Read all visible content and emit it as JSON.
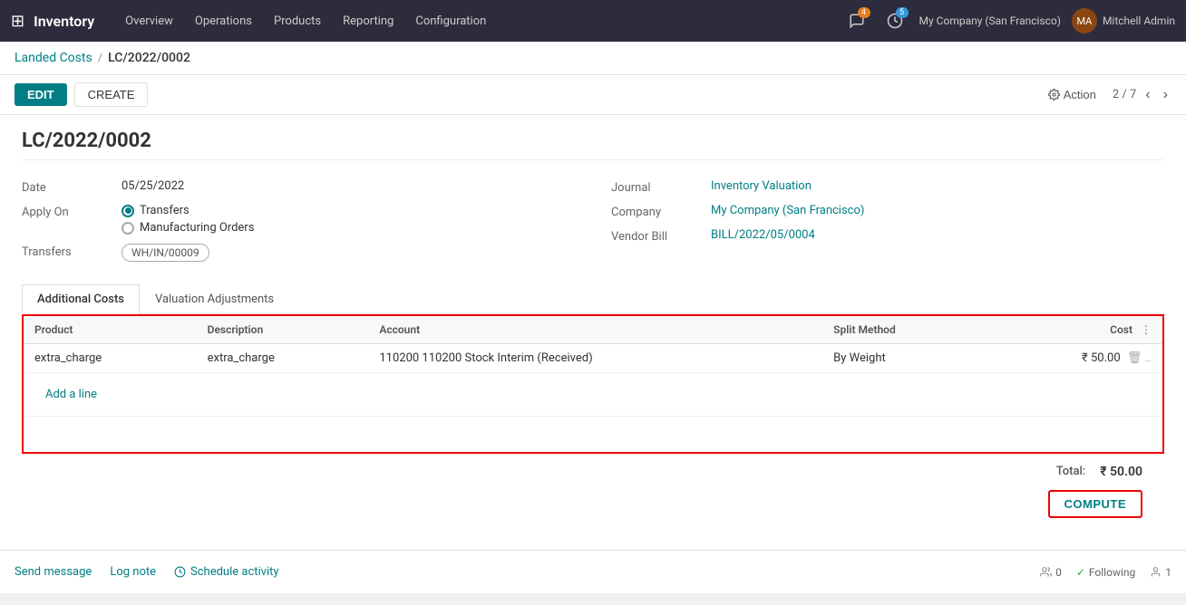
{
  "topnav": {
    "brand": "Inventory",
    "items": [
      {
        "label": "Overview",
        "id": "overview"
      },
      {
        "label": "Operations",
        "id": "operations"
      },
      {
        "label": "Products",
        "id": "products"
      },
      {
        "label": "Reporting",
        "id": "reporting"
      },
      {
        "label": "Configuration",
        "id": "configuration"
      }
    ],
    "notification_count": "4",
    "activity_count": "5",
    "company": "My Company (San Francisco)",
    "user": "Mitchell Admin"
  },
  "breadcrumb": {
    "parent": "Landed Costs",
    "separator": "/",
    "current": "LC/2022/0002"
  },
  "toolbar": {
    "edit_label": "EDIT",
    "create_label": "CREATE",
    "action_label": "Action",
    "pagination": "2 / 7"
  },
  "record": {
    "title": "LC/2022/0002",
    "date_label": "Date",
    "date_value": "05/25/2022",
    "apply_on_label": "Apply On",
    "apply_on_transfers": "Transfers",
    "apply_on_mfg": "Manufacturing Orders",
    "transfers_label": "Transfers",
    "transfers_value": "WH/IN/00009",
    "journal_label": "Journal",
    "journal_value": "Inventory Valuation",
    "company_label": "Company",
    "company_value": "My Company (San Francisco)",
    "vendor_bill_label": "Vendor Bill",
    "vendor_bill_value": "BILL/2022/05/0004"
  },
  "tabs": [
    {
      "label": "Additional Costs",
      "id": "additional-costs",
      "active": true
    },
    {
      "label": "Valuation Adjustments",
      "id": "valuation-adjustments",
      "active": false
    }
  ],
  "table": {
    "headers": [
      {
        "label": "Product",
        "id": "product"
      },
      {
        "label": "Description",
        "id": "description"
      },
      {
        "label": "Account",
        "id": "account"
      },
      {
        "label": "Split Method",
        "id": "split-method"
      },
      {
        "label": "Cost",
        "id": "cost"
      }
    ],
    "rows": [
      {
        "product": "extra_charge",
        "description": "extra_charge",
        "account": "110200 110200 Stock Interim (Received)",
        "split_method": "By Weight",
        "cost": "₹ 50.00"
      }
    ],
    "add_line_label": "Add a line"
  },
  "total": {
    "label": "Total:",
    "value": "₹ 50.00"
  },
  "compute_button": "COMPUTE",
  "footer": {
    "send_message": "Send message",
    "log_note": "Log note",
    "schedule_activity": "Schedule activity",
    "followers_count": "0",
    "following_label": "Following",
    "users_count": "1"
  }
}
